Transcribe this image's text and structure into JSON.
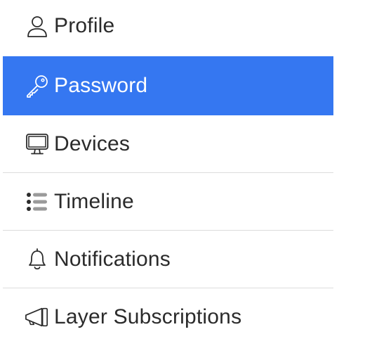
{
  "menu": {
    "items": [
      {
        "label": "Profile",
        "icon": "user-icon",
        "active": false
      },
      {
        "label": "Password",
        "icon": "key-icon",
        "active": true
      },
      {
        "label": "Devices",
        "icon": "monitor-icon",
        "active": false
      },
      {
        "label": "Timeline",
        "icon": "list-icon",
        "active": false
      },
      {
        "label": "Notifications",
        "icon": "bell-icon",
        "active": false
      },
      {
        "label": "Layer Subscriptions",
        "icon": "megaphone-icon",
        "active": false
      }
    ]
  },
  "colors": {
    "active_background": "#3577f1",
    "active_text": "#ffffff",
    "text": "#2b2b2b",
    "divider": "#dcdcdc"
  }
}
